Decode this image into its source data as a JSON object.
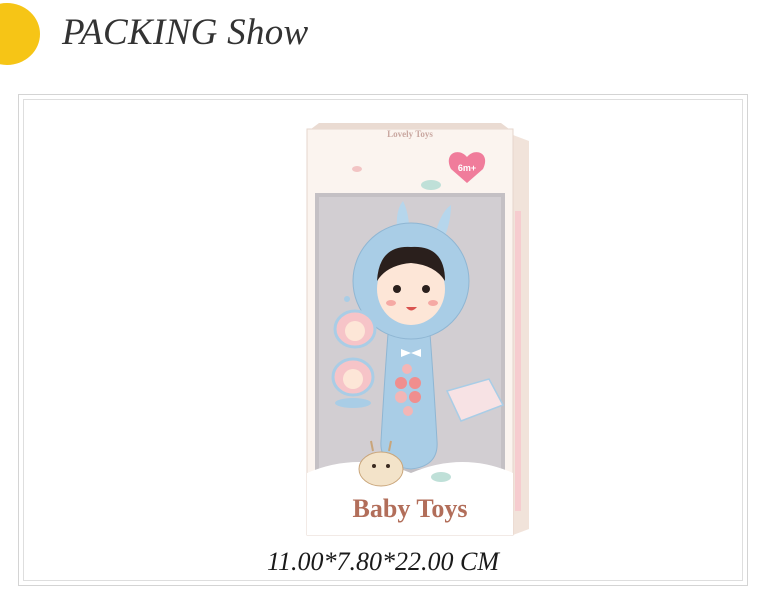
{
  "header": {
    "title": "PACKING Show",
    "badge_icon": "arrow-right-icon",
    "accent_color": "#f6c516"
  },
  "product": {
    "box_top_text": "Lovely Toys",
    "age_badge": "6m+",
    "brand_text": "Baby Toys",
    "caption": "11.00*7.80*22.00 CM",
    "toy_color": "#a9cde6",
    "box_color": "#fbf4ef"
  }
}
